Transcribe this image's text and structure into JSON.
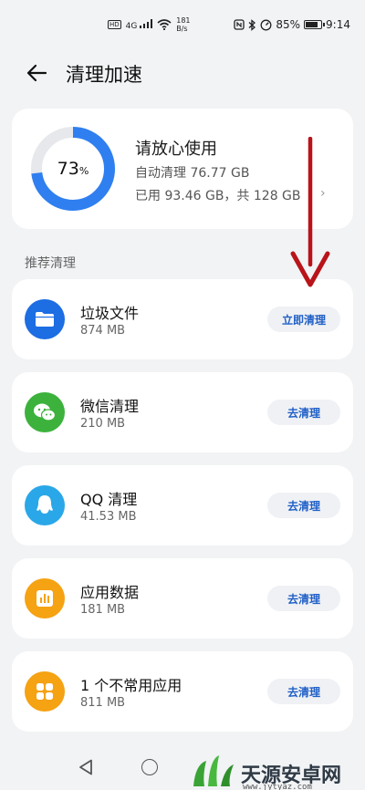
{
  "status_bar": {
    "hd": "HD",
    "signal": "4G",
    "speed_value": "181",
    "speed_unit": "B/s",
    "battery": "85%",
    "time": "9:14"
  },
  "header": {
    "title": "清理加速"
  },
  "summary": {
    "percent": "73",
    "percent_sign": "%",
    "percent_value": 73,
    "title": "请放心使用",
    "auto_clean": "自动清理 76.77 GB",
    "usage": "已用 93.46 GB，共 128 GB",
    "chevron": "›"
  },
  "section_label": "推荐清理",
  "items": [
    {
      "title": "垃圾文件",
      "size": "874 MB",
      "button": "立即清理",
      "icon": "folder-icon",
      "color": "#1d6de3"
    },
    {
      "title": "微信清理",
      "size": "210 MB",
      "button": "去清理",
      "icon": "wechat-icon",
      "color": "#3cb23c"
    },
    {
      "title": "QQ 清理",
      "size": "41.53 MB",
      "button": "去清理",
      "icon": "qq-icon",
      "color": "#2aa7e8"
    },
    {
      "title": "应用数据",
      "size": "181 MB",
      "button": "去清理",
      "icon": "app-data-icon",
      "color": "#f5a213"
    },
    {
      "title": "1 个不常用应用",
      "size": "811 MB",
      "button": "去清理",
      "icon": "apps-grid-icon",
      "color": "#f5a213"
    }
  ],
  "watermark": {
    "name": "天源安卓网",
    "url": "www.jytyaz.com"
  },
  "colors": {
    "ring_fill": "#2f7ff0",
    "ring_track": "#e6e8eb",
    "annotation": "#b8141a"
  }
}
